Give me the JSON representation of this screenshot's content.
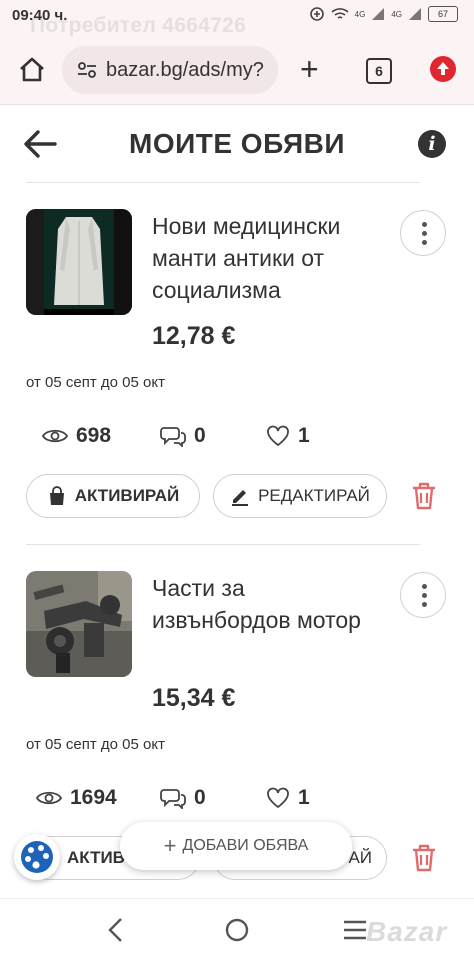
{
  "status_bar": {
    "time": "09:40 ч.",
    "ghost_user": "Потребител 4664726",
    "battery": "67",
    "network": "4G"
  },
  "browser": {
    "url": "bazar.bg/ads/my?",
    "tab_count": "6"
  },
  "header": {
    "title": "МОИТЕ ОБЯВИ"
  },
  "ads": [
    {
      "title": "Нови медицински манти антики от социализма",
      "price": "12,78 €",
      "dates": "от 05 септ до 05 окт",
      "views": "698",
      "messages": "0",
      "favorites": "1",
      "activate_label": "АКТИВИРАЙ",
      "edit_label": "РЕДАКТИРАЙ"
    },
    {
      "title": "Части за извънбордов мотор",
      "price": "15,34 €",
      "dates": "от 05 септ до 05 окт",
      "views": "1694",
      "messages": "0",
      "favorites": "1",
      "activate_label": "АКТИВ",
      "edit_label": "АЙ"
    }
  ],
  "fab": {
    "add_label": "ДОБАВИ ОБЯВА"
  },
  "watermark": "Bazar",
  "colors": {
    "accent_red": "#e0262f",
    "trash_red": "#e06b6b",
    "text": "#333333",
    "browser_bg": "#fcf3f4"
  }
}
